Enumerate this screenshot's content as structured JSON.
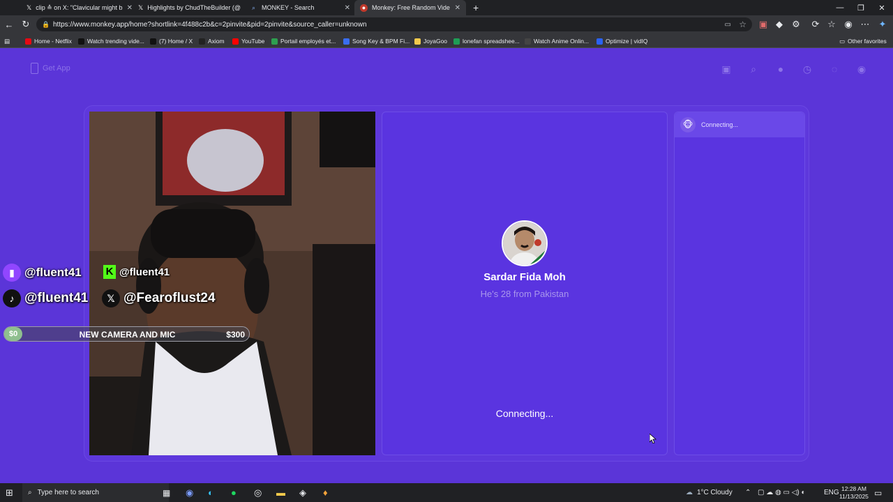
{
  "browser": {
    "tabs": [
      {
        "title": "clip ≙ on X: \"Clavicular might b",
        "icon": "x-icon",
        "active": false
      },
      {
        "title": "Highlights by ChudTheBuilder (@",
        "icon": "x-icon",
        "active": false
      },
      {
        "title": "MONKEY - Search",
        "icon": "search-icon",
        "active": false
      },
      {
        "title": "Monkey: Free Random Vide",
        "icon": "monkey-icon",
        "active": true
      }
    ],
    "url": "https://www.monkey.app/home?shortlink=4f488c2b&c=2pinvite&pid=2pinvite&source_caller=unknown",
    "bookmarks": [
      {
        "label": "Home - Netflix",
        "color": "#e50914"
      },
      {
        "label": "Watch trending vide...",
        "color": "#111111"
      },
      {
        "label": "(7) Home / X",
        "color": "#111111"
      },
      {
        "label": "Axiom",
        "color": "#222222"
      },
      {
        "label": "YouTube",
        "color": "#ff0000"
      },
      {
        "label": "Portail employés et...",
        "color": "#2e9e4f"
      },
      {
        "label": "Song Key & BPM Fi...",
        "color": "#3a6df0"
      },
      {
        "label": "JoyaGoo",
        "color": "#f2c94c"
      },
      {
        "label": "lonefan spreadshee...",
        "color": "#1f9d55"
      },
      {
        "label": "Watch Anime Onlin...",
        "color": "#444444"
      },
      {
        "label": "Optimize | vidIQ",
        "color": "#2b62f2"
      }
    ],
    "other_favorites": "Other favorites"
  },
  "monkey": {
    "get_app": "Get App",
    "chat_status": "Connecting...",
    "peer": {
      "name": "Sardar Fida Moh",
      "info": "He's 28 from Pakistan"
    },
    "status": "Connecting..."
  },
  "overlay": {
    "twitch": "@fluent41",
    "kick": "@fluent41",
    "tiktok": "@fluent41",
    "x": "@Fearoflust24",
    "goal": {
      "start": "$0",
      "label": "NEW CAMERA AND MIC",
      "target": "$300",
      "progress": 0.0
    }
  },
  "taskbar": {
    "search_placeholder": "Type here to search",
    "weather": "1°C  Cloudy",
    "lang": "ENG",
    "time": "12:28 AM",
    "date": "11/13/2025"
  }
}
